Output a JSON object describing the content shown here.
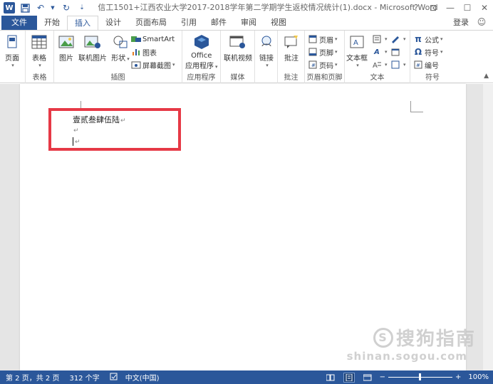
{
  "window": {
    "title": "信工1501+江西农业大学2017-2018学年第二学期学生返校情况统计(1).docx - Microsoft Word",
    "app_icon": "W",
    "controls": [
      "?",
      "⊡",
      "—",
      "☐",
      "✕"
    ]
  },
  "tabs": {
    "file": "文件",
    "items": [
      "开始",
      "插入",
      "设计",
      "页面布局",
      "引用",
      "邮件",
      "审阅",
      "视图"
    ],
    "active": "插入",
    "login": "登录"
  },
  "ribbon": {
    "groups": {
      "pages": {
        "label": "页面",
        "btn": "页面"
      },
      "tables": {
        "label": "表格",
        "btn": "表格"
      },
      "illustrations": {
        "label": "插图",
        "picture": "图片",
        "online_picture": "联机图片",
        "shapes": "形状",
        "smartart": "SmartArt",
        "chart": "图表",
        "screenshot": "屏幕截图"
      },
      "apps": {
        "label": "应用程序",
        "btn_line1": "Office",
        "btn_line2": "应用程序"
      },
      "media": {
        "label": "媒体",
        "btn": "联机视频"
      },
      "links": {
        "label": "",
        "btn": "链接"
      },
      "comments": {
        "label": "批注",
        "btn": "批注"
      },
      "header_footer": {
        "label": "页眉和页脚",
        "header": "页眉",
        "footer": "页脚",
        "page_number": "页码"
      },
      "text": {
        "label": "文本",
        "textbox": "文本框"
      },
      "symbols": {
        "label": "符号",
        "equation": "公式",
        "symbol": "符号",
        "numbering": "编号"
      }
    }
  },
  "document": {
    "lines": [
      "壹贰叁肆伍陆",
      "",
      ""
    ],
    "para_mark": "↵"
  },
  "watermark": {
    "logo": "S",
    "text": "搜狗指南",
    "url": "shinan.sogou.com"
  },
  "statusbar": {
    "page": "第 2 页，共 2 页",
    "words": "312 个字",
    "language": "中文(中国)",
    "zoom": "100%",
    "zoom_minus": "−",
    "zoom_plus": "+"
  },
  "colors": {
    "accent": "#2b579a",
    "highlight": "#e63946"
  }
}
